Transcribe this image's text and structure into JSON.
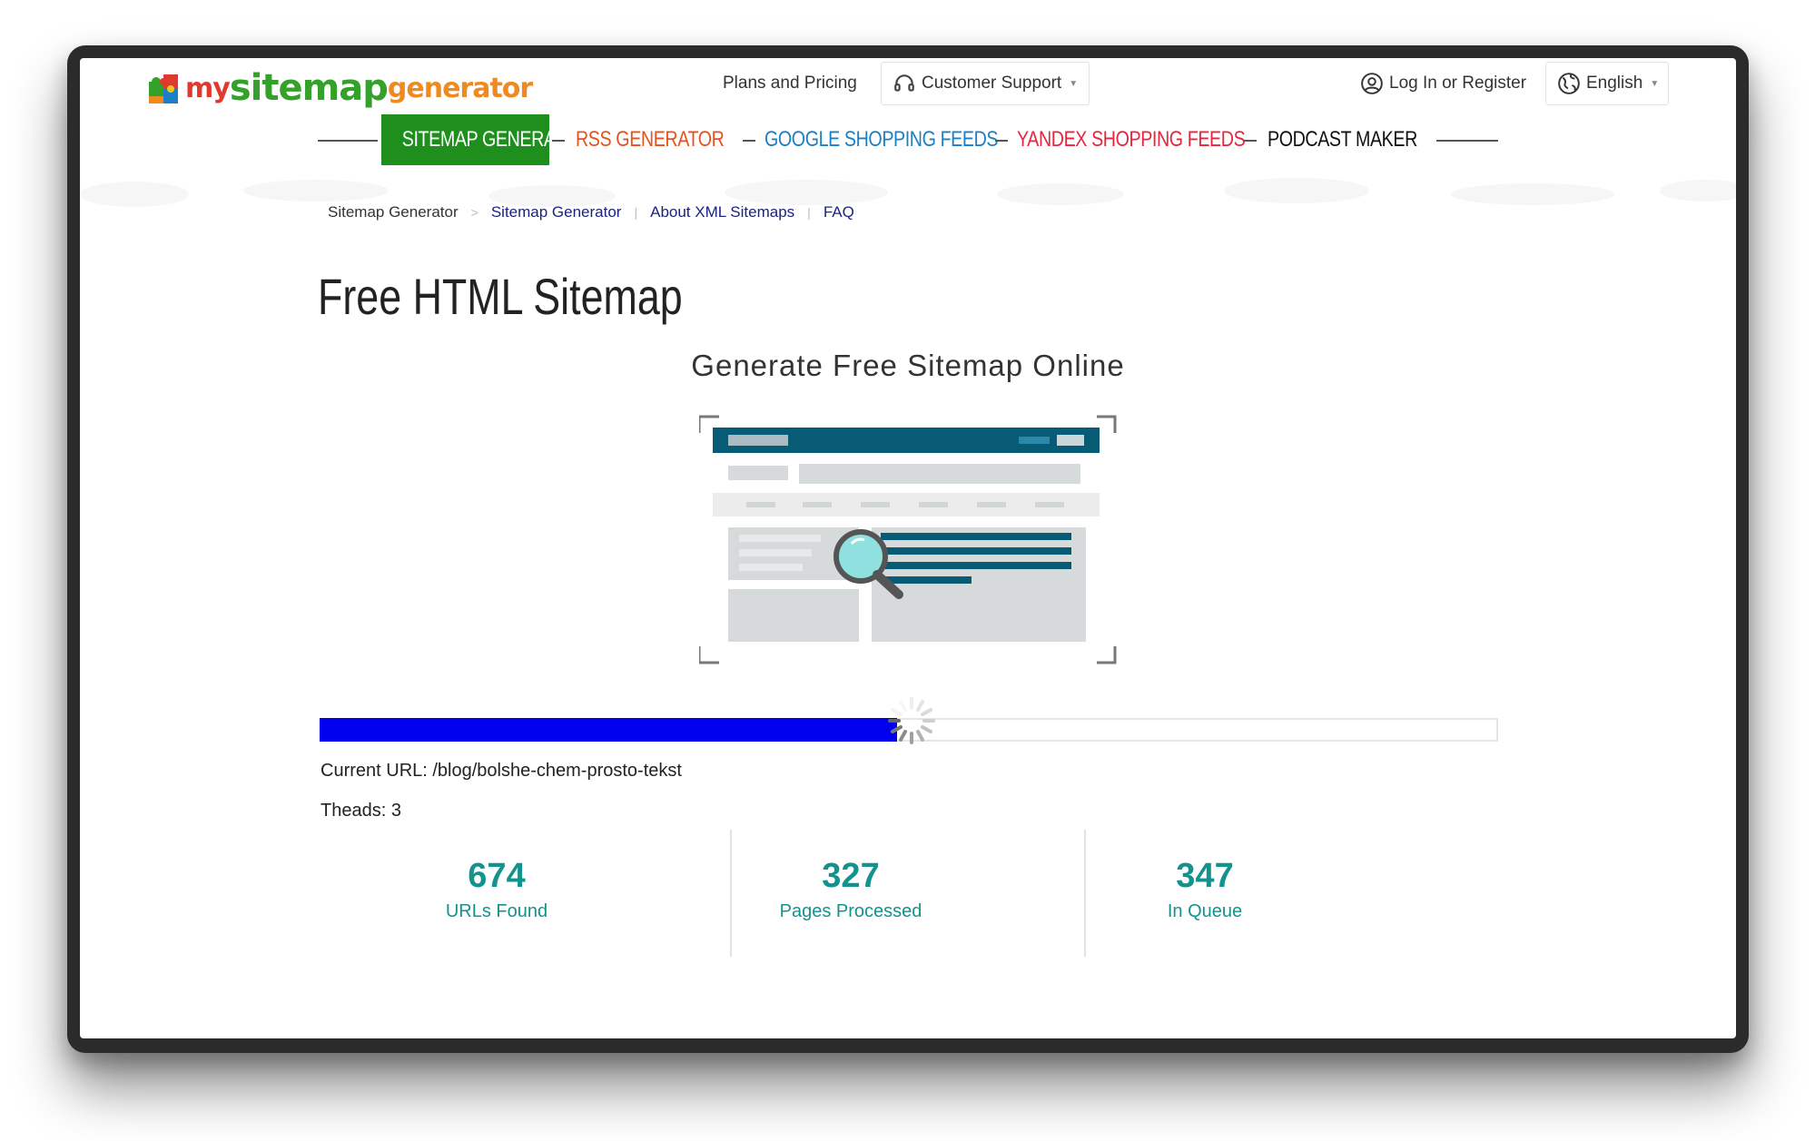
{
  "header": {
    "logo": {
      "my": "my",
      "site": "sitemap",
      "gen": "generator"
    },
    "plans_label": "Plans and Pricing",
    "support_label": "Customer Support",
    "login_label": "Log In or Register",
    "language_label": "English"
  },
  "products": [
    {
      "label": "SITEMAP GENERATOR",
      "color": "#ffffff",
      "active": true
    },
    {
      "label": "RSS GENERATOR",
      "color": "#e8511c"
    },
    {
      "label": "GOOGLE SHOPPING FEEDS",
      "color": "#1a7fc4"
    },
    {
      "label": "YANDEX SHOPPING FEEDS",
      "color": "#e8253c"
    },
    {
      "label": "PODCAST MAKER",
      "color": "#111111"
    }
  ],
  "breadcrumb": {
    "home": "Sitemap Generator",
    "links": [
      "Sitemap Generator",
      "About XML Sitemaps",
      "FAQ"
    ]
  },
  "page": {
    "title": "Free HTML Sitemap",
    "subtitle": "Generate Free Sitemap Online"
  },
  "progress": {
    "fraction": 0.49,
    "current_url": "Current URL: /blog/bolshe-chem-prosto-tekst",
    "threads": "Theads: 3"
  },
  "stats": [
    {
      "value": "674",
      "label": "URLs Found"
    },
    {
      "value": "327",
      "label": "Pages Processed"
    },
    {
      "value": "347",
      "label": "In Queue"
    }
  ],
  "colors": {
    "accent_green": "#1e8f1c",
    "progress_blue": "#0000ee",
    "stat_teal": "#12938d",
    "link_navy": "#1a237e"
  }
}
